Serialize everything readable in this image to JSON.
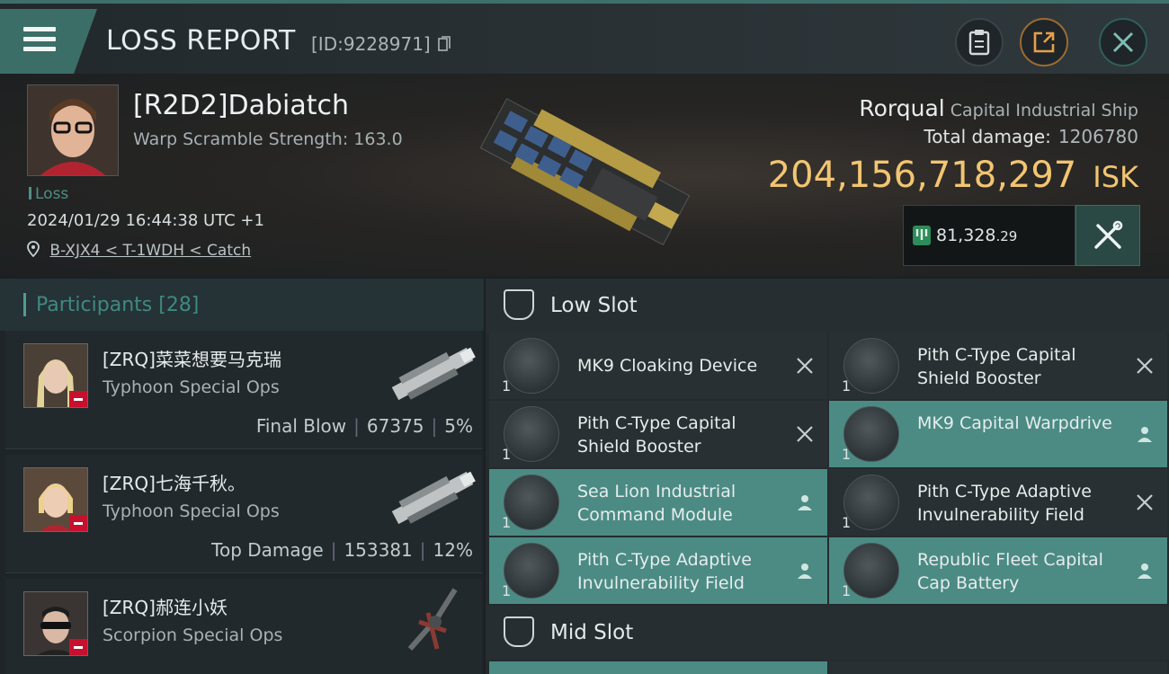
{
  "header": {
    "title": "LOSS REPORT",
    "report_id": "[ID:9228971]"
  },
  "victim": {
    "name": "[R2D2]Dabiatch",
    "warp_scramble": "Warp Scramble Strength: 163.0",
    "status": "Loss",
    "datetime": "2024/01/29 16:44:38 UTC +1",
    "location": "B-XJX4 < T-1WDH < Catch"
  },
  "ship": {
    "name": "Rorqual",
    "class": "Capital Industrial Ship",
    "total_damage_label": "Total damage:",
    "total_damage_value": "1206780",
    "isk_value": "204,156,718,297",
    "isk_unit": "ISK",
    "points_main": "81,328",
    "points_decimal": ".29"
  },
  "participants": {
    "label": "Participants",
    "count": "[28]",
    "rows": [
      {
        "name": "[ZRQ]菜菜想要马克瑞",
        "ship": "Typhoon Special Ops",
        "role": "Final Blow",
        "damage": "67375",
        "percent": "5%"
      },
      {
        "name": "[ZRQ]七海千秋。",
        "ship": "Typhoon Special Ops",
        "role": "Top Damage",
        "damage": "153381",
        "percent": "12%"
      },
      {
        "name": "[ZRQ]郝连小妖",
        "ship": "Scorpion Special Ops",
        "role": "",
        "damage": "",
        "percent": ""
      }
    ]
  },
  "slots": {
    "low_label": "Low Slot",
    "mid_label": "Mid Slot",
    "low_modules": [
      {
        "name": "MK9 Cloaking Device",
        "qty": "1",
        "state": "destroyed"
      },
      {
        "name": "Pith C-Type Capital Shield Booster",
        "qty": "1",
        "state": "destroyed"
      },
      {
        "name": "Pith C-Type Capital Shield Booster",
        "qty": "1",
        "state": "destroyed"
      },
      {
        "name": "MK9 Capital Warpdrive",
        "qty": "1",
        "state": "dropped"
      },
      {
        "name": "Sea Lion Industrial Command Module",
        "qty": "1",
        "state": "dropped"
      },
      {
        "name": "Pith C-Type Adaptive Invulnerability Field",
        "qty": "1",
        "state": "destroyed"
      },
      {
        "name": "Pith C-Type Adaptive Invulnerability Field",
        "qty": "1",
        "state": "dropped"
      },
      {
        "name": "Republic Fleet Capital Cap Battery",
        "qty": "1",
        "state": "dropped"
      }
    ]
  },
  "colors": {
    "accent": "#4b8b84",
    "isk_gold": "#f2c571",
    "loss_red": "#c8102e"
  }
}
